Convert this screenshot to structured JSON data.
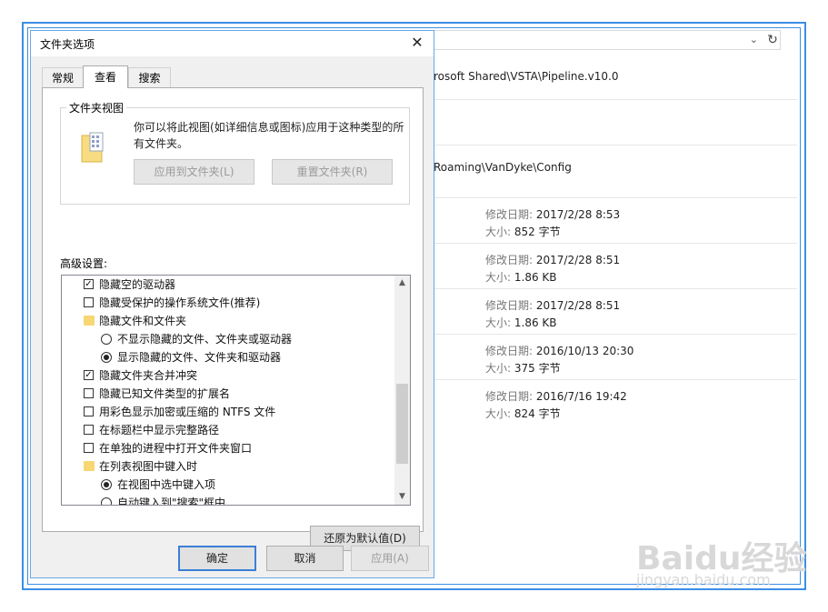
{
  "explorer": {
    "rows": [
      {
        "path": "rosoft Shared\\VSTA\\Pipeline.v10.0"
      },
      {
        "path": ""
      },
      {
        "path": "Roaming\\VanDyke\\Config"
      },
      {
        "modified_label": "修改日期:",
        "modified": "2017/2/28 8:53",
        "size_label": "大小:",
        "size": "852 字节"
      },
      {
        "modified_label": "修改日期:",
        "modified": "2017/2/28 8:51",
        "size_label": "大小:",
        "size": "1.86 KB"
      },
      {
        "modified_label": "修改日期:",
        "modified": "2017/2/28 8:51",
        "size_label": "大小:",
        "size": "1.86 KB"
      },
      {
        "modified_label": "修改日期:",
        "modified": "2016/10/13 20:30",
        "size_label": "大小:",
        "size": "375 字节"
      },
      {
        "modified_label": "修改日期:",
        "modified": "2016/7/16 19:42",
        "size_label": "大小:",
        "size": "824 字节"
      }
    ]
  },
  "dialog": {
    "title": "文件夹选项",
    "tabs": [
      "常规",
      "查看",
      "搜索"
    ],
    "folder_view": {
      "group_title": "文件夹视图",
      "description": "你可以将此视图(如详细信息或图标)应用于这种类型的所有文件夹。",
      "apply_button": "应用到文件夹(L)",
      "reset_button": "重置文件夹(R)"
    },
    "advanced_label": "高级设置:",
    "advanced_items": [
      {
        "type": "checkbox",
        "checked": true,
        "label": "隐藏空的驱动器"
      },
      {
        "type": "checkbox",
        "checked": false,
        "label": "隐藏受保护的操作系统文件(推荐)"
      },
      {
        "type": "folder",
        "label": "隐藏文件和文件夹"
      },
      {
        "type": "radio",
        "checked": false,
        "label": "不显示隐藏的文件、文件夹或驱动器"
      },
      {
        "type": "radio",
        "checked": true,
        "label": "显示隐藏的文件、文件夹和驱动器"
      },
      {
        "type": "checkbox",
        "checked": true,
        "label": "隐藏文件夹合并冲突"
      },
      {
        "type": "checkbox",
        "checked": false,
        "label": "隐藏已知文件类型的扩展名"
      },
      {
        "type": "checkbox",
        "checked": false,
        "label": "用彩色显示加密或压缩的 NTFS 文件"
      },
      {
        "type": "checkbox",
        "checked": false,
        "label": "在标题栏中显示完整路径"
      },
      {
        "type": "checkbox",
        "checked": false,
        "label": "在单独的进程中打开文件夹窗口"
      },
      {
        "type": "folder",
        "label": "在列表视图中键入时"
      },
      {
        "type": "radio",
        "checked": true,
        "label": "在视图中选中键入项"
      },
      {
        "type": "radio",
        "checked": false,
        "label": "自动键入到\"搜索\"框中"
      }
    ],
    "restore_defaults": "还原为默认值(D)",
    "ok": "确定",
    "cancel": "取消",
    "apply": "应用(A)"
  },
  "watermark": {
    "brand": "Baidu经验",
    "url": "jingyan.baidu.com"
  }
}
